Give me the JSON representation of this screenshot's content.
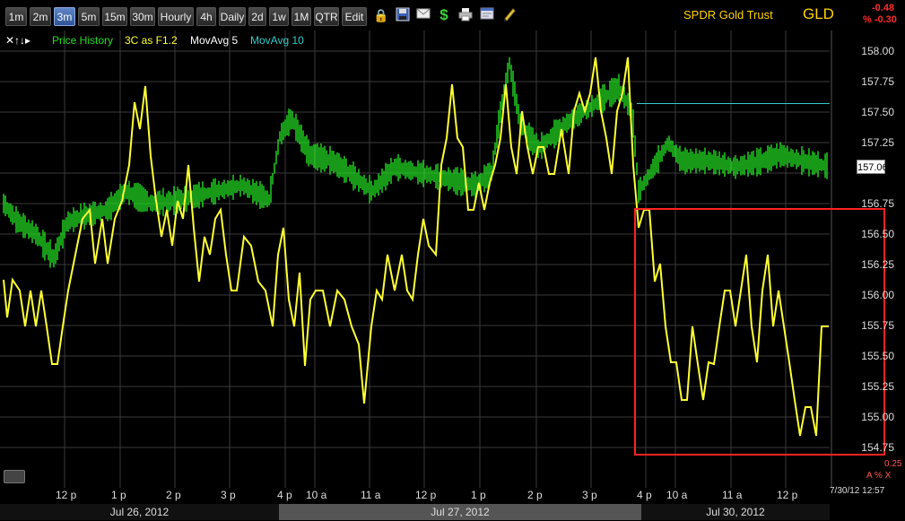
{
  "toolbar": {
    "timeframes": [
      "1m",
      "2m",
      "3m",
      "5m",
      "15m",
      "30m",
      "Hourly",
      "4h",
      "Daily",
      "2d",
      "1w",
      "1M",
      "QTR",
      "Edit"
    ],
    "active": "3m",
    "icons": [
      "lock-icon",
      "save-icon",
      "mail-icon",
      "dollar-icon",
      "print-icon",
      "window-icon",
      "pencil-icon"
    ]
  },
  "header": {
    "name": "SPDR Gold Trust",
    "symbol": "GLD",
    "change": "-0.48",
    "change_pct": "% -0.30"
  },
  "legend": {
    "controls": "✕↑↓▸",
    "items": [
      "Price History",
      "3C as F1.2",
      "MovAvg 5",
      "MovAvg 10"
    ],
    "colors": [
      "#22dd22",
      "#ffff33",
      "#ffffff",
      "#33cccc"
    ]
  },
  "price_axis": {
    "labels": [
      "158.00",
      "157.75",
      "157.50",
      "157.25",
      "156.75",
      "156.50",
      "156.25",
      "156.00",
      "155.75",
      "155.50",
      "155.25",
      "155.00",
      "154.75"
    ],
    "current": "157.06"
  },
  "time_axis": {
    "labels": [
      "12 p",
      "1 p",
      "2 p",
      "3 p",
      "4 p",
      "10 a",
      "11 a",
      "12 p",
      "1 p",
      "2 p",
      "3 p",
      "4 p",
      "10 a",
      "11 a",
      "12 p"
    ],
    "dates": [
      "Jul 26, 2012",
      "Jul 27, 2012",
      "Jul 30, 2012"
    ]
  },
  "footer": {
    "indicator_value": "0.25",
    "controls": "A % X",
    "timestamp": "7/30/12 12:57"
  },
  "chart_data": {
    "type": "line",
    "series": [
      {
        "name": "Price History",
        "color": "#22dd22"
      },
      {
        "name": "3C as F1.2",
        "color": "#ffff33"
      },
      {
        "name": "MovAvg 10",
        "color": "#33cccc"
      }
    ],
    "ylim": [
      154.7,
      158.05
    ],
    "xlabel": "",
    "ylabel": ""
  },
  "annotation": {
    "type": "rectangle",
    "color": "#ff2222"
  }
}
